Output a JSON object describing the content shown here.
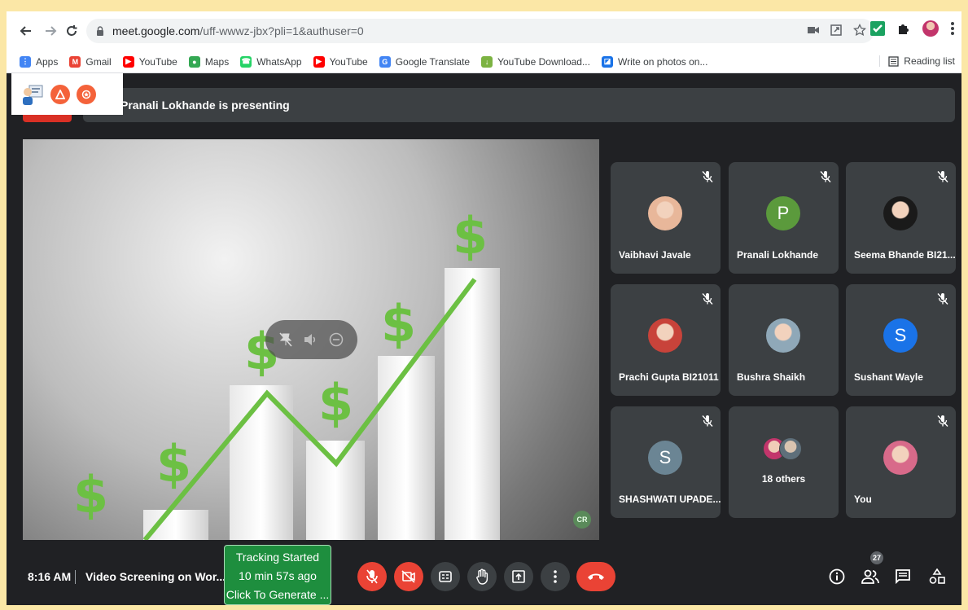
{
  "browser": {
    "url_domain": "meet.google.com",
    "url_path": "/uff-wwwz-jbx?pli=1&authuser=0"
  },
  "bookmarks": [
    {
      "label": "Apps",
      "icon": "apps-grid-icon",
      "color": "#4285f4"
    },
    {
      "label": "Gmail",
      "icon": "gmail-icon",
      "color": "#ea4335"
    },
    {
      "label": "YouTube",
      "icon": "youtube-icon",
      "color": "#ff0000"
    },
    {
      "label": "Maps",
      "icon": "maps-pin-icon",
      "color": "#34a853"
    },
    {
      "label": "WhatsApp",
      "icon": "whatsapp-icon",
      "color": "#25d366"
    },
    {
      "label": "YouTube",
      "icon": "youtube-icon",
      "color": "#ff0000"
    },
    {
      "label": "Google Translate",
      "icon": "translate-icon",
      "color": "#4285f4"
    },
    {
      "label": "YouTube Download...",
      "icon": "download-arrow-icon",
      "color": "#7cb342"
    },
    {
      "label": "Write on photos on...",
      "icon": "photo-icon",
      "color": "#1a73e8"
    }
  ],
  "reading_list": "Reading list",
  "presenting": {
    "text": "Pranali Lokhande is presenting"
  },
  "participants": [
    {
      "name": "Vaibhavi Javale",
      "initial": "",
      "avatar_color": "#e8b79a",
      "muted": true
    },
    {
      "name": "Pranali Lokhande",
      "initial": "P",
      "avatar_color": "#5b9a3c",
      "muted": true
    },
    {
      "name": "Seema Bhande BI21...",
      "initial": "",
      "avatar_color": "#1a1a1a",
      "muted": true
    },
    {
      "name": "Prachi Gupta BI21011",
      "initial": "",
      "avatar_color": "#c8433a",
      "muted": true
    },
    {
      "name": "Bushra Shaikh",
      "initial": "",
      "avatar_color": "#8fa8b8",
      "muted": false
    },
    {
      "name": "Sushant Wayle",
      "initial": "S",
      "avatar_color": "#1a73e8",
      "muted": true
    },
    {
      "name": "SHASHWATI UPADE...",
      "initial": "S",
      "avatar_color": "#6b8594",
      "muted": true
    },
    {
      "name": "18 others",
      "initial": "",
      "avatar_color": "#9aa0a6",
      "muted": false
    },
    {
      "name": "You",
      "initial": "",
      "avatar_color": "#d86a8a",
      "muted": true
    }
  ],
  "bottom_bar": {
    "time": "8:16 AM",
    "meeting_title": "Video Screening on Wor...",
    "tracking_line1": "Tracking Started",
    "tracking_line2": "10 min 57s ago",
    "tracking_line3": "Click To Generate ...",
    "participant_count": "27"
  },
  "stage": {
    "watermark": "CR"
  },
  "colors": {
    "meet_bg": "#202124",
    "tile_bg": "#3c4043",
    "danger": "#ea4335",
    "tracking": "#1e8e3e"
  }
}
